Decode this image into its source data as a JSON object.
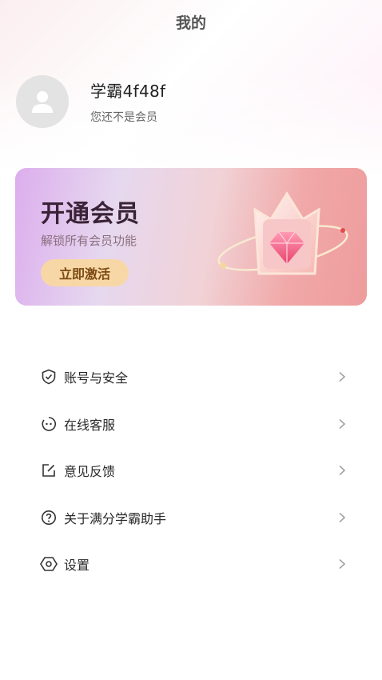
{
  "page": {
    "title": "我的"
  },
  "profile": {
    "username": "学霸4f48f",
    "member_status": "您还不是会员"
  },
  "vip_card": {
    "title": "开通会员",
    "subtitle": "解锁所有会员功能",
    "button_label": "立即激活"
  },
  "menu": {
    "items": [
      {
        "label": "账号与安全",
        "icon": "shield-check-icon"
      },
      {
        "label": "在线客服",
        "icon": "customer-service-icon"
      },
      {
        "label": "意见反馈",
        "icon": "edit-feedback-icon"
      },
      {
        "label": "关于满分学霸助手",
        "icon": "help-circle-icon"
      },
      {
        "label": "设置",
        "icon": "settings-hexagon-icon"
      }
    ]
  },
  "colors": {
    "vip_button": "#f8d7a6",
    "vip_title": "#3a2336"
  }
}
